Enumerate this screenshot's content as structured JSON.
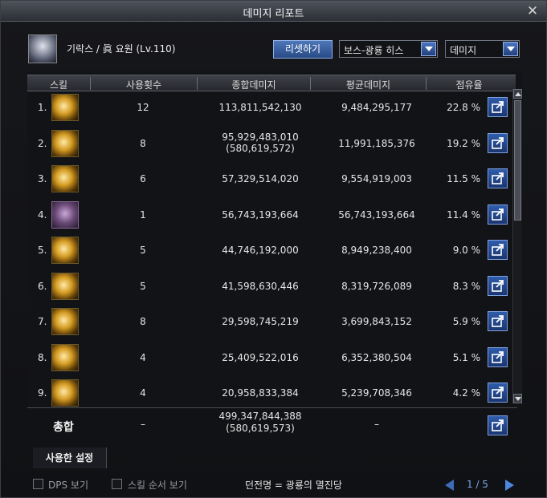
{
  "window": {
    "title": "데미지 리포트"
  },
  "character": {
    "name": "기락스 / 眞 요원 (Lv.110)"
  },
  "controls": {
    "reset_label": "리셋하기",
    "boss_filter": "보스-광룡 히스",
    "metric_filter": "데미지"
  },
  "table": {
    "headers": [
      "스킬",
      "사용횟수",
      "종합데미지",
      "평균데미지",
      "점유율"
    ],
    "rows": [
      {
        "rank": "1.",
        "uses": "12",
        "total": "113,811,542,130",
        "total_sub": "",
        "avg": "9,484,295,177",
        "share": "22.8 %"
      },
      {
        "rank": "2.",
        "uses": "8",
        "total": "95,929,483,010",
        "total_sub": "(580,619,572)",
        "avg": "11,991,185,376",
        "share": "19.2 %"
      },
      {
        "rank": "3.",
        "uses": "6",
        "total": "57,329,514,020",
        "total_sub": "",
        "avg": "9,554,919,003",
        "share": "11.5 %"
      },
      {
        "rank": "4.",
        "uses": "1",
        "total": "56,743,193,664",
        "total_sub": "",
        "avg": "56,743,193,664",
        "share": "11.4 %"
      },
      {
        "rank": "5.",
        "uses": "5",
        "total": "44,746,192,000",
        "total_sub": "",
        "avg": "8,949,238,400",
        "share": "9.0 %"
      },
      {
        "rank": "6.",
        "uses": "5",
        "total": "41,598,630,446",
        "total_sub": "",
        "avg": "8,319,726,089",
        "share": "8.3 %"
      },
      {
        "rank": "7.",
        "uses": "8",
        "total": "29,598,745,219",
        "total_sub": "",
        "avg": "3,699,843,152",
        "share": "5.9 %"
      },
      {
        "rank": "8.",
        "uses": "4",
        "total": "25,409,522,016",
        "total_sub": "",
        "avg": "6,352,380,504",
        "share": "5.1 %"
      },
      {
        "rank": "9.",
        "uses": "4",
        "total": "20,958,833,384",
        "total_sub": "",
        "avg": "5,239,708,346",
        "share": "4.2 %"
      }
    ]
  },
  "total": {
    "label": "총합",
    "uses": "–",
    "sum": "499,347,844,388",
    "sum_sub": "(580,619,573)",
    "avg": "–"
  },
  "footer": {
    "used_settings_label": "사용한 설정",
    "dps_label": "DPS 보기",
    "skill_order_label": "스킬 순서 보기",
    "dungeon": "던전명 = 광룡의 멸진당",
    "pager": "1 / 5"
  }
}
